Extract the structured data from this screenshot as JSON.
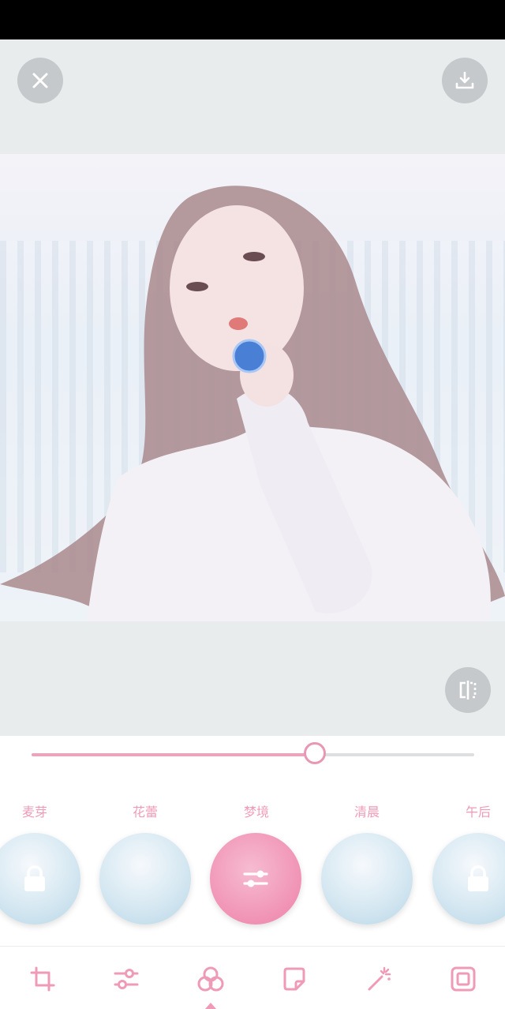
{
  "top_bar": {
    "close_icon": "close-icon",
    "download_icon": "download-icon"
  },
  "photo": {
    "description_icon": "photo-preview"
  },
  "compare_icon": "compare-icon",
  "intensity_slider": {
    "value": 0.64
  },
  "filters": [
    {
      "label": "麦芽",
      "locked": true,
      "selected": false
    },
    {
      "label": "花蕾",
      "locked": false,
      "selected": false
    },
    {
      "label": "梦境",
      "locked": false,
      "selected": true
    },
    {
      "label": "清晨",
      "locked": false,
      "selected": false
    },
    {
      "label": "午后",
      "locked": true,
      "selected": false
    }
  ],
  "toolbar": [
    {
      "icon": "crop-icon"
    },
    {
      "icon": "adjust-icon"
    },
    {
      "icon": "filter-icon",
      "active": true
    },
    {
      "icon": "sticker-icon"
    },
    {
      "icon": "magic-wand-icon"
    },
    {
      "icon": "frame-icon"
    }
  ],
  "colors": {
    "accent_pink": "#ef9bb7",
    "background": "#e9eced"
  }
}
